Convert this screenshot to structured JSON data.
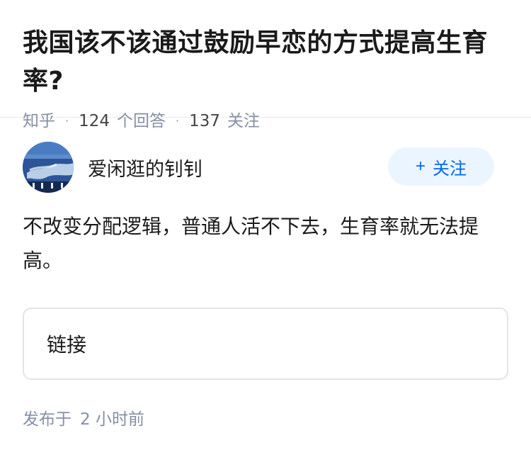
{
  "question": {
    "title": "我国该不该通过鼓励早恋的方式提高生育率?",
    "source": "知乎",
    "answer_count": "124",
    "answer_label": "个回答",
    "follower_count": "137",
    "follower_label": "关注"
  },
  "answer": {
    "author_name": "爱闲逛的钊钊",
    "follow_button": {
      "icon": "+",
      "label": "关注"
    },
    "content": "不改变分配逻辑，普通人活不下去，生育率就无法提高。",
    "link_card": {
      "label": "链接"
    },
    "publish": {
      "prefix": "发布于",
      "time": "2 小时前"
    }
  },
  "colors": {
    "accent": "#0066ff",
    "follow_bg": "#ebf5ff",
    "meta": "#8590a6"
  }
}
